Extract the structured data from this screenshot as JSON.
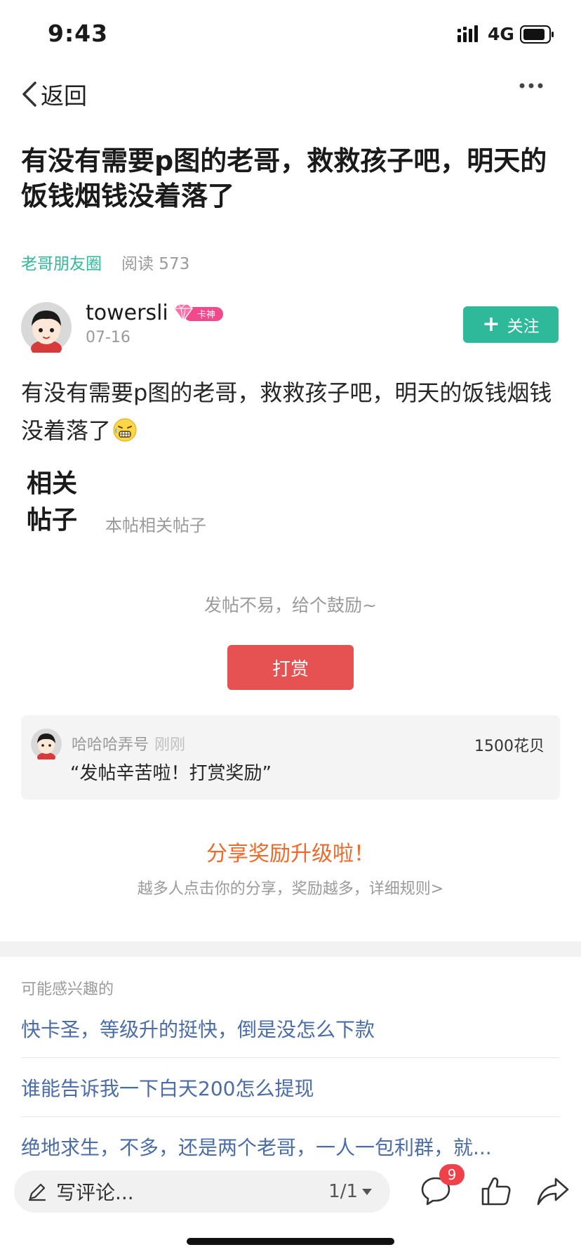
{
  "status_bar": {
    "time": "9:43",
    "network": "4G"
  },
  "nav": {
    "back_label": "返回"
  },
  "post": {
    "title": "有没有需要p图的老哥，救救孩子吧，明天的饭钱烟钱没着落了",
    "circle": "老哥朋友圈",
    "reads": "阅读 573",
    "author": {
      "name": "towersli",
      "badge": "卡神",
      "date": "07-16"
    },
    "follow_label": "关注",
    "body": "有没有需要p图的老哥，救救孩子吧，明天的饭钱烟钱没着落了",
    "body_emoji": "grimace-emoji"
  },
  "related": {
    "title": "相关帖子",
    "subtitle": "本帖相关帖子"
  },
  "reward": {
    "prompt": "发帖不易，给个鼓励~",
    "button_label": "打赏",
    "record": {
      "name": "哈哈哈弄号",
      "time": "刚刚",
      "amount": "1500花贝",
      "message": "“发帖辛苦啦！打赏奖励”"
    }
  },
  "share": {
    "title": "分享奖励升级啦！",
    "subtitle": "越多人点击你的分享，奖励越多，详细规则>"
  },
  "suggestions": {
    "heading": "可能感兴趣的",
    "items": [
      {
        "text": "快卡圣，等级升的挺快，倒是没怎么下款"
      },
      {
        "text": "谁能告诉我一下白天200怎么提现"
      },
      {
        "text": "绝地求生，不多，还是两个老哥，一人一包利群，就..."
      }
    ]
  },
  "bottom_bar": {
    "comment_placeholder": "写评论...",
    "page_indicator": "1/1",
    "comment_count": "9"
  },
  "colors": {
    "accent_green": "#2fb99b",
    "reward_red": "#e65252",
    "share_orange": "#ef6a2a",
    "link_blue": "#4a6da7",
    "badge_pink": "#f04a8c"
  }
}
